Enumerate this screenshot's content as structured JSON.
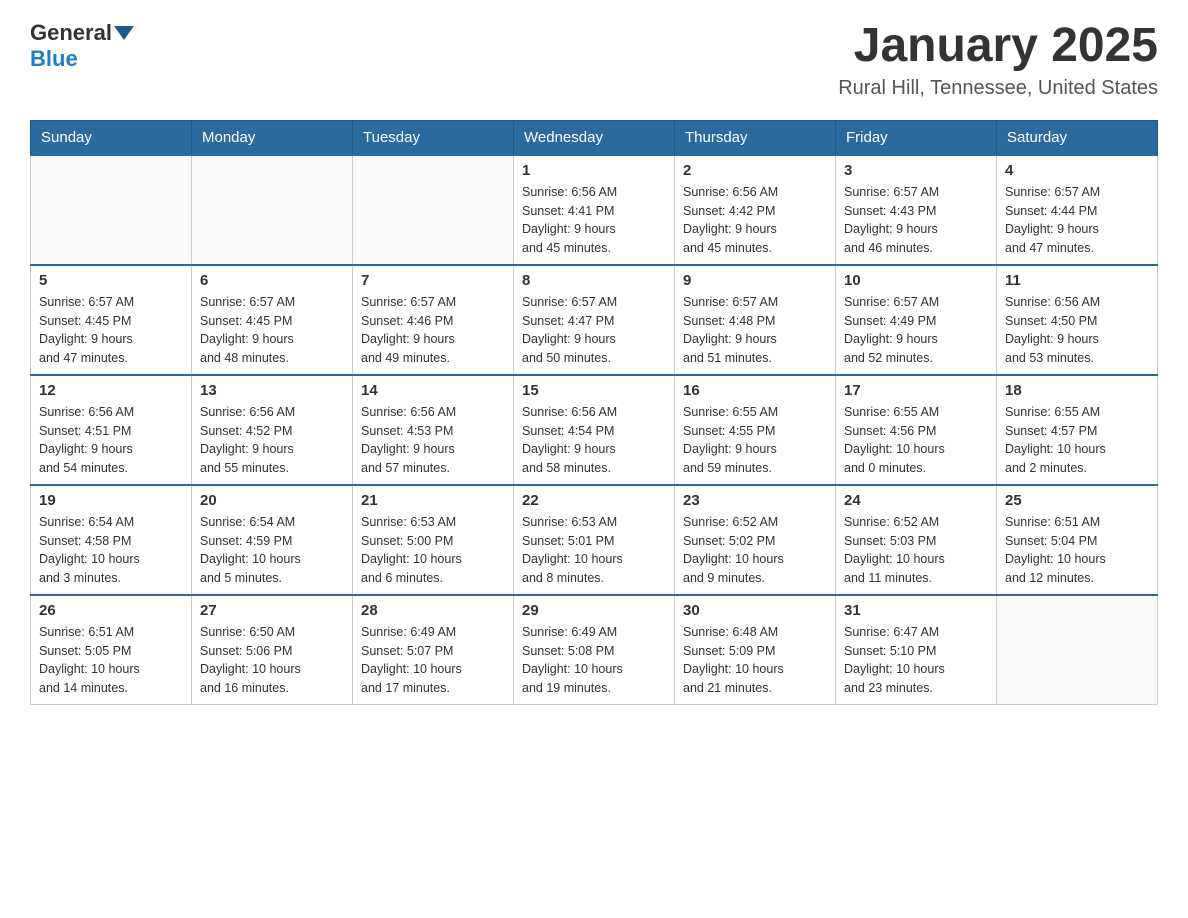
{
  "header": {
    "logo": {
      "general": "General",
      "blue": "Blue"
    },
    "title": "January 2025",
    "subtitle": "Rural Hill, Tennessee, United States"
  },
  "weekdays": [
    "Sunday",
    "Monday",
    "Tuesday",
    "Wednesday",
    "Thursday",
    "Friday",
    "Saturday"
  ],
  "weeks": [
    [
      {
        "day": "",
        "info": ""
      },
      {
        "day": "",
        "info": ""
      },
      {
        "day": "",
        "info": ""
      },
      {
        "day": "1",
        "info": "Sunrise: 6:56 AM\nSunset: 4:41 PM\nDaylight: 9 hours\nand 45 minutes."
      },
      {
        "day": "2",
        "info": "Sunrise: 6:56 AM\nSunset: 4:42 PM\nDaylight: 9 hours\nand 45 minutes."
      },
      {
        "day": "3",
        "info": "Sunrise: 6:57 AM\nSunset: 4:43 PM\nDaylight: 9 hours\nand 46 minutes."
      },
      {
        "day": "4",
        "info": "Sunrise: 6:57 AM\nSunset: 4:44 PM\nDaylight: 9 hours\nand 47 minutes."
      }
    ],
    [
      {
        "day": "5",
        "info": "Sunrise: 6:57 AM\nSunset: 4:45 PM\nDaylight: 9 hours\nand 47 minutes."
      },
      {
        "day": "6",
        "info": "Sunrise: 6:57 AM\nSunset: 4:45 PM\nDaylight: 9 hours\nand 48 minutes."
      },
      {
        "day": "7",
        "info": "Sunrise: 6:57 AM\nSunset: 4:46 PM\nDaylight: 9 hours\nand 49 minutes."
      },
      {
        "day": "8",
        "info": "Sunrise: 6:57 AM\nSunset: 4:47 PM\nDaylight: 9 hours\nand 50 minutes."
      },
      {
        "day": "9",
        "info": "Sunrise: 6:57 AM\nSunset: 4:48 PM\nDaylight: 9 hours\nand 51 minutes."
      },
      {
        "day": "10",
        "info": "Sunrise: 6:57 AM\nSunset: 4:49 PM\nDaylight: 9 hours\nand 52 minutes."
      },
      {
        "day": "11",
        "info": "Sunrise: 6:56 AM\nSunset: 4:50 PM\nDaylight: 9 hours\nand 53 minutes."
      }
    ],
    [
      {
        "day": "12",
        "info": "Sunrise: 6:56 AM\nSunset: 4:51 PM\nDaylight: 9 hours\nand 54 minutes."
      },
      {
        "day": "13",
        "info": "Sunrise: 6:56 AM\nSunset: 4:52 PM\nDaylight: 9 hours\nand 55 minutes."
      },
      {
        "day": "14",
        "info": "Sunrise: 6:56 AM\nSunset: 4:53 PM\nDaylight: 9 hours\nand 57 minutes."
      },
      {
        "day": "15",
        "info": "Sunrise: 6:56 AM\nSunset: 4:54 PM\nDaylight: 9 hours\nand 58 minutes."
      },
      {
        "day": "16",
        "info": "Sunrise: 6:55 AM\nSunset: 4:55 PM\nDaylight: 9 hours\nand 59 minutes."
      },
      {
        "day": "17",
        "info": "Sunrise: 6:55 AM\nSunset: 4:56 PM\nDaylight: 10 hours\nand 0 minutes."
      },
      {
        "day": "18",
        "info": "Sunrise: 6:55 AM\nSunset: 4:57 PM\nDaylight: 10 hours\nand 2 minutes."
      }
    ],
    [
      {
        "day": "19",
        "info": "Sunrise: 6:54 AM\nSunset: 4:58 PM\nDaylight: 10 hours\nand 3 minutes."
      },
      {
        "day": "20",
        "info": "Sunrise: 6:54 AM\nSunset: 4:59 PM\nDaylight: 10 hours\nand 5 minutes."
      },
      {
        "day": "21",
        "info": "Sunrise: 6:53 AM\nSunset: 5:00 PM\nDaylight: 10 hours\nand 6 minutes."
      },
      {
        "day": "22",
        "info": "Sunrise: 6:53 AM\nSunset: 5:01 PM\nDaylight: 10 hours\nand 8 minutes."
      },
      {
        "day": "23",
        "info": "Sunrise: 6:52 AM\nSunset: 5:02 PM\nDaylight: 10 hours\nand 9 minutes."
      },
      {
        "day": "24",
        "info": "Sunrise: 6:52 AM\nSunset: 5:03 PM\nDaylight: 10 hours\nand 11 minutes."
      },
      {
        "day": "25",
        "info": "Sunrise: 6:51 AM\nSunset: 5:04 PM\nDaylight: 10 hours\nand 12 minutes."
      }
    ],
    [
      {
        "day": "26",
        "info": "Sunrise: 6:51 AM\nSunset: 5:05 PM\nDaylight: 10 hours\nand 14 minutes."
      },
      {
        "day": "27",
        "info": "Sunrise: 6:50 AM\nSunset: 5:06 PM\nDaylight: 10 hours\nand 16 minutes."
      },
      {
        "day": "28",
        "info": "Sunrise: 6:49 AM\nSunset: 5:07 PM\nDaylight: 10 hours\nand 17 minutes."
      },
      {
        "day": "29",
        "info": "Sunrise: 6:49 AM\nSunset: 5:08 PM\nDaylight: 10 hours\nand 19 minutes."
      },
      {
        "day": "30",
        "info": "Sunrise: 6:48 AM\nSunset: 5:09 PM\nDaylight: 10 hours\nand 21 minutes."
      },
      {
        "day": "31",
        "info": "Sunrise: 6:47 AM\nSunset: 5:10 PM\nDaylight: 10 hours\nand 23 minutes."
      },
      {
        "day": "",
        "info": ""
      }
    ]
  ]
}
